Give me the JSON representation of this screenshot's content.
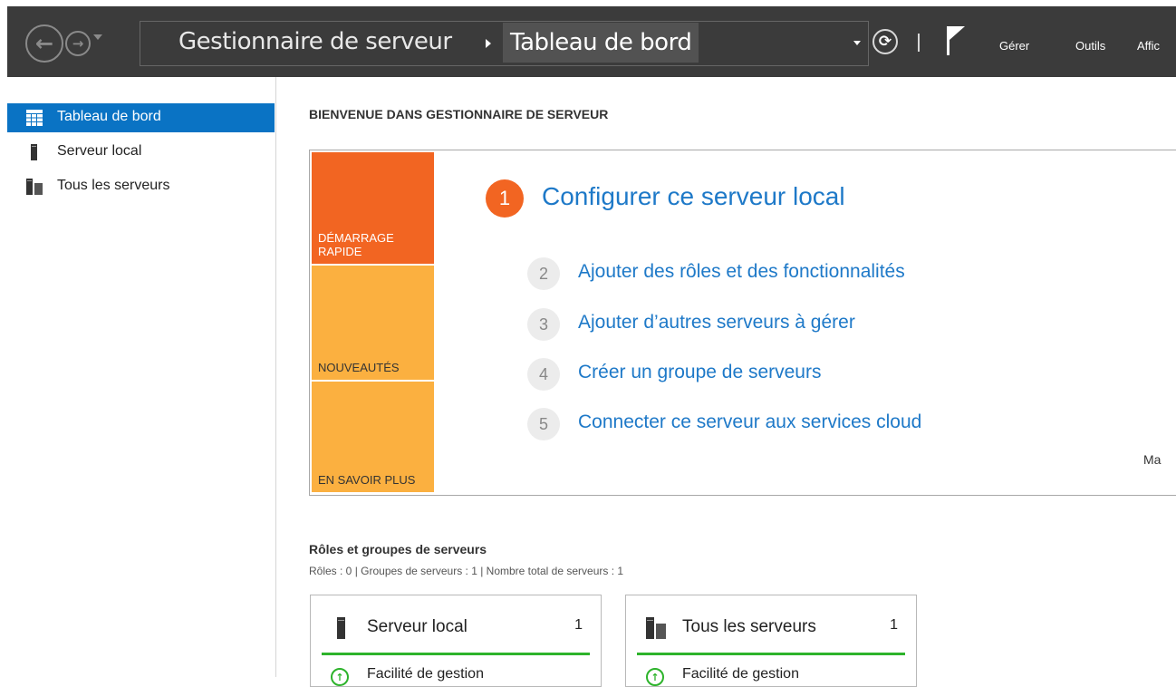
{
  "header": {
    "breadcrumb_root": "Gestionnaire de serveur",
    "breadcrumb_current": "Tableau de bord",
    "menu": [
      "Gérer",
      "Outils",
      "Affic"
    ]
  },
  "sidebar": {
    "items": [
      {
        "label": "Tableau de bord",
        "icon": "dashboard-icon",
        "active": true
      },
      {
        "label": "Serveur local",
        "icon": "server-icon",
        "active": false
      },
      {
        "label": "Tous les serveurs",
        "icon": "servers-icon",
        "active": false
      }
    ]
  },
  "welcome": {
    "title": "BIENVENUE DANS GESTIONNAIRE DE SERVEUR",
    "tiles": [
      "DÉMARRAGE RAPIDE",
      "NOUVEAUTÉS",
      "EN SAVOIR PLUS"
    ],
    "steps": [
      {
        "num": "1",
        "label": "Configurer ce serveur local"
      },
      {
        "num": "2",
        "label": "Ajouter des rôles et des fonctionnalités"
      },
      {
        "num": "3",
        "label": "Ajouter d’autres serveurs à gérer"
      },
      {
        "num": "4",
        "label": "Créer un groupe de serveurs"
      },
      {
        "num": "5",
        "label": "Connecter ce serveur aux services cloud"
      }
    ],
    "cutoff_text": "Ma"
  },
  "roles": {
    "title": "Rôles et groupes de serveurs",
    "summary": "Rôles : 0  |  Groupes de serveurs : 1  |  Nombre total de serveurs : 1",
    "cards": [
      {
        "title": "Serveur local",
        "count": "1",
        "status": "Facilité de gestion"
      },
      {
        "title": "Tous les serveurs",
        "count": "1",
        "status": "Facilité de gestion"
      }
    ]
  },
  "colors": {
    "active_blue": "#0a73c4",
    "link_blue": "#1e79c8",
    "tile_orange": "#f26522",
    "tile_yellow": "#fbb040",
    "status_green": "#2db32b",
    "header_bg": "#3b3b3b"
  }
}
